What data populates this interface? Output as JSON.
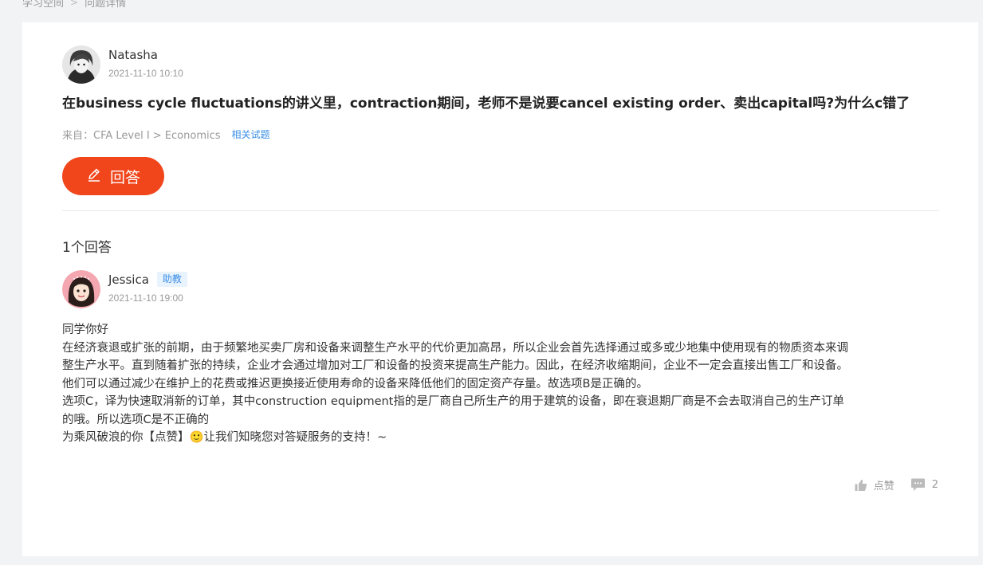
{
  "breadcrumb": {
    "items": [
      "学习空间",
      "问题详情"
    ]
  },
  "question": {
    "author": "Natasha",
    "time": "2021-11-10 10:10",
    "title": "在business cycle fluctuations的讲义里，contraction期间，老师不是说要cancel existing order、卖出capital吗?为什么c错了",
    "source_label": "来自：CFA Level I > Economics",
    "related_link": "相关试题"
  },
  "answer_button": {
    "label": "回答",
    "icon": "pencil-icon"
  },
  "answers": {
    "count_label": "1个回答",
    "items": [
      {
        "author": "Jessica",
        "role": "助教",
        "time": "2021-11-10 19:00",
        "paragraphs": [
          "同学你好",
          "在经济衰退或扩张的前期，由于频繁地买卖厂房和设备来调整生产水平的代价更加高昂，所以企业会首先选择通过或多或少地集中使用现有的物质资本来调整生产水平。直到随着扩张的持续，企业才会通过增加对工厂和设备的投资来提高生产能力。因此，在经济收缩期间，企业不一定会直接出售工厂和设备。他们可以通过减少在维护上的花费或推迟更换接近使用寿命的设备来降低他们的固定资产存量。故选项B是正确的。",
          "选项C，译为快速取消新的订单，其中construction equipment指的是厂商自己所生产的用于建筑的设备，即在衰退期厂商是不会去取消自己的生产订单的哦。所以选项C是不正确的",
          "为乘风破浪的你【点赞】🙂让我们知晓您对答疑服务的支持！~"
        ],
        "like_label": "点赞",
        "comment_count": "2"
      }
    ]
  },
  "colors": {
    "primary": "#f1461c",
    "link": "#3a8ee6",
    "badge_bg": "#e8f3fd"
  }
}
